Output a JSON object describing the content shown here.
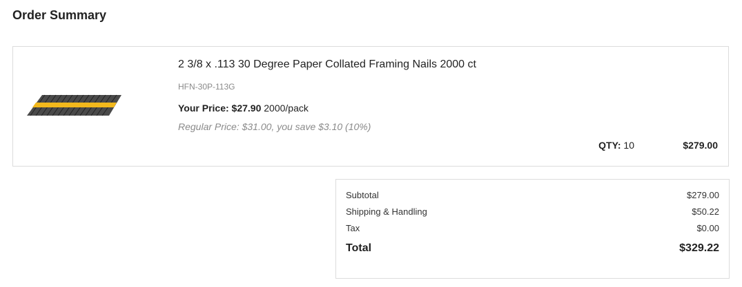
{
  "page": {
    "title": "Order Summary"
  },
  "item": {
    "name": "2 3/8 x .113 30 Degree Paper Collated Framing Nails 2000 ct",
    "sku": "HFN-30P-113G",
    "your_price_label": "Your Price:",
    "your_price_value": "$27.90",
    "unit": "2000/pack",
    "regular_price_text": "Regular Price: $31.00, you save $3.10 (10%)",
    "qty_label": "QTY:",
    "qty_value": "10",
    "line_total": "$279.00",
    "image_icon": "framing-nails-strip",
    "colors": {
      "nail_strip": "#3a3a3a",
      "collation_tape": "#f2b81c"
    }
  },
  "totals": {
    "subtotal_label": "Subtotal",
    "subtotal_value": "$279.00",
    "shipping_label": "Shipping & Handling",
    "shipping_value": "$50.22",
    "tax_label": "Tax",
    "tax_value": "$0.00",
    "total_label": "Total",
    "total_value": "$329.22"
  }
}
